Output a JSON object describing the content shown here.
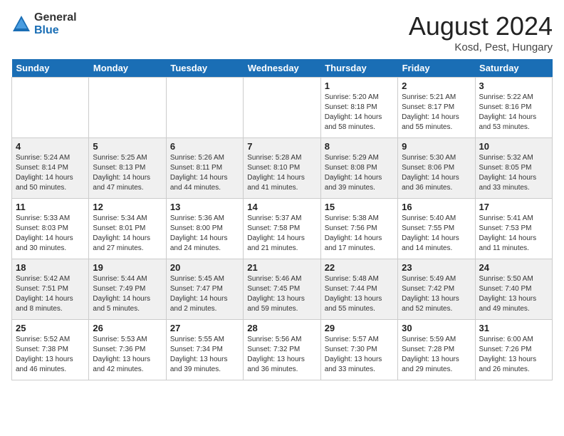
{
  "header": {
    "logo_general": "General",
    "logo_blue": "Blue",
    "title": "August 2024",
    "subtitle": "Kosd, Pest, Hungary"
  },
  "days_of_week": [
    "Sunday",
    "Monday",
    "Tuesday",
    "Wednesday",
    "Thursday",
    "Friday",
    "Saturday"
  ],
  "weeks": [
    [
      {
        "day": "",
        "info": ""
      },
      {
        "day": "",
        "info": ""
      },
      {
        "day": "",
        "info": ""
      },
      {
        "day": "",
        "info": ""
      },
      {
        "day": "1",
        "info": "Sunrise: 5:20 AM\nSunset: 8:18 PM\nDaylight: 14 hours\nand 58 minutes."
      },
      {
        "day": "2",
        "info": "Sunrise: 5:21 AM\nSunset: 8:17 PM\nDaylight: 14 hours\nand 55 minutes."
      },
      {
        "day": "3",
        "info": "Sunrise: 5:22 AM\nSunset: 8:16 PM\nDaylight: 14 hours\nand 53 minutes."
      }
    ],
    [
      {
        "day": "4",
        "info": "Sunrise: 5:24 AM\nSunset: 8:14 PM\nDaylight: 14 hours\nand 50 minutes."
      },
      {
        "day": "5",
        "info": "Sunrise: 5:25 AM\nSunset: 8:13 PM\nDaylight: 14 hours\nand 47 minutes."
      },
      {
        "day": "6",
        "info": "Sunrise: 5:26 AM\nSunset: 8:11 PM\nDaylight: 14 hours\nand 44 minutes."
      },
      {
        "day": "7",
        "info": "Sunrise: 5:28 AM\nSunset: 8:10 PM\nDaylight: 14 hours\nand 41 minutes."
      },
      {
        "day": "8",
        "info": "Sunrise: 5:29 AM\nSunset: 8:08 PM\nDaylight: 14 hours\nand 39 minutes."
      },
      {
        "day": "9",
        "info": "Sunrise: 5:30 AM\nSunset: 8:06 PM\nDaylight: 14 hours\nand 36 minutes."
      },
      {
        "day": "10",
        "info": "Sunrise: 5:32 AM\nSunset: 8:05 PM\nDaylight: 14 hours\nand 33 minutes."
      }
    ],
    [
      {
        "day": "11",
        "info": "Sunrise: 5:33 AM\nSunset: 8:03 PM\nDaylight: 14 hours\nand 30 minutes."
      },
      {
        "day": "12",
        "info": "Sunrise: 5:34 AM\nSunset: 8:01 PM\nDaylight: 14 hours\nand 27 minutes."
      },
      {
        "day": "13",
        "info": "Sunrise: 5:36 AM\nSunset: 8:00 PM\nDaylight: 14 hours\nand 24 minutes."
      },
      {
        "day": "14",
        "info": "Sunrise: 5:37 AM\nSunset: 7:58 PM\nDaylight: 14 hours\nand 21 minutes."
      },
      {
        "day": "15",
        "info": "Sunrise: 5:38 AM\nSunset: 7:56 PM\nDaylight: 14 hours\nand 17 minutes."
      },
      {
        "day": "16",
        "info": "Sunrise: 5:40 AM\nSunset: 7:55 PM\nDaylight: 14 hours\nand 14 minutes."
      },
      {
        "day": "17",
        "info": "Sunrise: 5:41 AM\nSunset: 7:53 PM\nDaylight: 14 hours\nand 11 minutes."
      }
    ],
    [
      {
        "day": "18",
        "info": "Sunrise: 5:42 AM\nSunset: 7:51 PM\nDaylight: 14 hours\nand 8 minutes."
      },
      {
        "day": "19",
        "info": "Sunrise: 5:44 AM\nSunset: 7:49 PM\nDaylight: 14 hours\nand 5 minutes."
      },
      {
        "day": "20",
        "info": "Sunrise: 5:45 AM\nSunset: 7:47 PM\nDaylight: 14 hours\nand 2 minutes."
      },
      {
        "day": "21",
        "info": "Sunrise: 5:46 AM\nSunset: 7:45 PM\nDaylight: 13 hours\nand 59 minutes."
      },
      {
        "day": "22",
        "info": "Sunrise: 5:48 AM\nSunset: 7:44 PM\nDaylight: 13 hours\nand 55 minutes."
      },
      {
        "day": "23",
        "info": "Sunrise: 5:49 AM\nSunset: 7:42 PM\nDaylight: 13 hours\nand 52 minutes."
      },
      {
        "day": "24",
        "info": "Sunrise: 5:50 AM\nSunset: 7:40 PM\nDaylight: 13 hours\nand 49 minutes."
      }
    ],
    [
      {
        "day": "25",
        "info": "Sunrise: 5:52 AM\nSunset: 7:38 PM\nDaylight: 13 hours\nand 46 minutes."
      },
      {
        "day": "26",
        "info": "Sunrise: 5:53 AM\nSunset: 7:36 PM\nDaylight: 13 hours\nand 42 minutes."
      },
      {
        "day": "27",
        "info": "Sunrise: 5:55 AM\nSunset: 7:34 PM\nDaylight: 13 hours\nand 39 minutes."
      },
      {
        "day": "28",
        "info": "Sunrise: 5:56 AM\nSunset: 7:32 PM\nDaylight: 13 hours\nand 36 minutes."
      },
      {
        "day": "29",
        "info": "Sunrise: 5:57 AM\nSunset: 7:30 PM\nDaylight: 13 hours\nand 33 minutes."
      },
      {
        "day": "30",
        "info": "Sunrise: 5:59 AM\nSunset: 7:28 PM\nDaylight: 13 hours\nand 29 minutes."
      },
      {
        "day": "31",
        "info": "Sunrise: 6:00 AM\nSunset: 7:26 PM\nDaylight: 13 hours\nand 26 minutes."
      }
    ]
  ]
}
